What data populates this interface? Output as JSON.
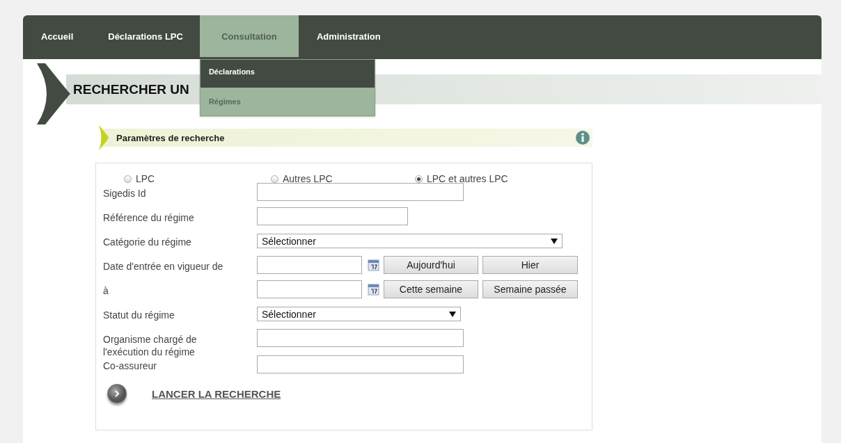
{
  "nav": [
    {
      "label": "Accueil",
      "selected": false
    },
    {
      "label": "Déclarations LPC",
      "selected": false
    },
    {
      "label": "Consultation",
      "selected": true
    },
    {
      "label": "Administration",
      "selected": false
    }
  ],
  "dropdown": [
    {
      "label": "Déclarations",
      "selected": false
    },
    {
      "label": "Régimes",
      "selected": true
    }
  ],
  "page_title": "RECHERCHER UN",
  "section_title": "Paramètres de recherche",
  "radios": [
    {
      "label": "LPC",
      "selected": false
    },
    {
      "label": "Autres LPC",
      "selected": false
    },
    {
      "label": "LPC et autres LPC",
      "selected": true
    }
  ],
  "fields": [
    {
      "kind": "text",
      "label": "Sigedis Id"
    },
    {
      "kind": "short",
      "label": "Référence du régime"
    },
    {
      "kind": "select-wide",
      "label": "Catégorie du régime",
      "value": "Sélectionner"
    },
    {
      "kind": "date",
      "label": "Date d'entrée en vigueur de",
      "buttons": [
        "Aujourd'hui",
        "Hier"
      ]
    },
    {
      "kind": "date",
      "label": "à",
      "buttons": [
        "Cette semaine",
        "Semaine passée"
      ]
    },
    {
      "kind": "select",
      "label": "Statut du régime",
      "value": "Sélectionner"
    },
    {
      "kind": "text",
      "label": "Organisme chargé de l'exécution du régime"
    },
    {
      "kind": "text",
      "label": "Co-assureur"
    }
  ],
  "submit": "LANCER LA RECHERCHE"
}
